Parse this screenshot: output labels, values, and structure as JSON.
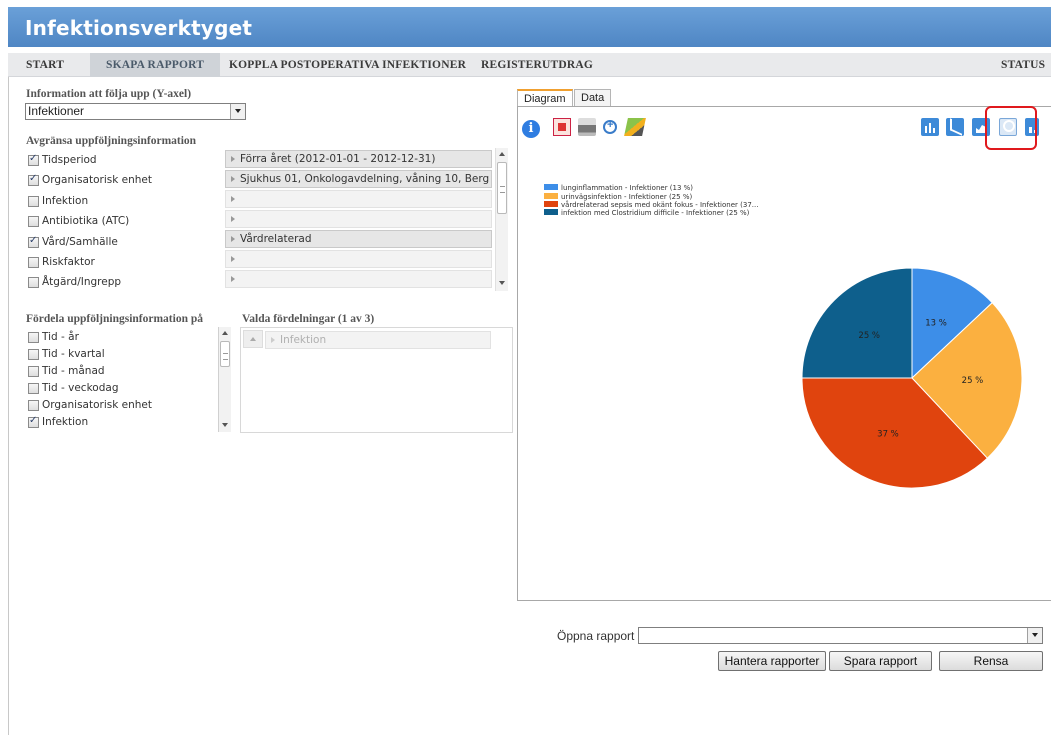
{
  "app": {
    "title": "Infektionsverktyget"
  },
  "nav": {
    "items": [
      {
        "label": "START"
      },
      {
        "label": "SKAPA RAPPORT"
      },
      {
        "label": "KOPPLA POSTOPERATIVA INFEKTIONER"
      },
      {
        "label": "REGISTERUTDRAG"
      },
      {
        "label": "STATUS"
      }
    ],
    "active": "SKAPA RAPPORT"
  },
  "y_axis": {
    "label": "Information att följa upp (Y-axel)",
    "selected": "Infektioner"
  },
  "filters": {
    "label": "Avgränsa uppföljningsinformation",
    "items": [
      {
        "label": "Tidsperiod",
        "checked": true,
        "value": "Förra året (2012-01-01 - 2012-12-31)"
      },
      {
        "label": "Organisatorisk enhet",
        "checked": true,
        "value": "Sjukhus 01, Onkologavdelning, våning 10, Berg"
      },
      {
        "label": "Infektion",
        "checked": false,
        "value": ""
      },
      {
        "label": "Antibiotika (ATC)",
        "checked": false,
        "value": ""
      },
      {
        "label": "Vård/Samhälle",
        "checked": true,
        "value": "Vårdrelaterad"
      },
      {
        "label": "Riskfaktor",
        "checked": false,
        "value": ""
      },
      {
        "label": "Åtgärd/Ingrepp",
        "checked": false,
        "value": ""
      }
    ]
  },
  "distribute": {
    "label": "Fördela uppföljningsinformation på",
    "items": [
      {
        "label": "Tid - år",
        "checked": false
      },
      {
        "label": "Tid - kvartal",
        "checked": false
      },
      {
        "label": "Tid - månad",
        "checked": false
      },
      {
        "label": "Tid - veckodag",
        "checked": false
      },
      {
        "label": "Organisatorisk enhet",
        "checked": false
      },
      {
        "label": "Infektion",
        "checked": true
      }
    ]
  },
  "selected_distributions": {
    "label": "Valda fördelningar (1 av 3)",
    "items": [
      "Infektion"
    ]
  },
  "tabs": [
    {
      "label": "Diagram",
      "active": true
    },
    {
      "label": "Data",
      "active": false
    }
  ],
  "toolbar": {
    "icons": [
      "info-icon",
      "pdf-export-icon",
      "print-icon",
      "zoom-icon",
      "edit-icon"
    ],
    "chart_types": [
      "bar-chart-icon",
      "line-chart-icon",
      "area-chart-icon",
      "pie-chart-icon",
      "more-chart-icon"
    ],
    "selected_chart_type": "pie-chart-icon"
  },
  "chart_data": {
    "type": "pie",
    "series": [
      {
        "name": "lunginflammation - Infektioner (13 %)",
        "value": 13,
        "label": "13 %",
        "color": "#3d8ee8"
      },
      {
        "name": "urinvägsinfektion - Infektioner (25 %)",
        "value": 25,
        "label": "25 %",
        "color": "#fbb040"
      },
      {
        "name": "vårdrelaterad sepsis med okänt fokus - Infektioner (37...",
        "value": 37,
        "label": "37 %",
        "color": "#e0440e"
      },
      {
        "name": "infektion med Clostridium difficile - Infektioner (25 %)",
        "value": 25,
        "label": "25 %",
        "color": "#0e5f8c"
      }
    ],
    "legend_position": "top-left"
  },
  "report": {
    "open_label": "Öppna rapport",
    "open_value": "",
    "buttons": {
      "manage": "Hantera rapporter",
      "save": "Spara rapport",
      "clear": "Rensa"
    }
  }
}
